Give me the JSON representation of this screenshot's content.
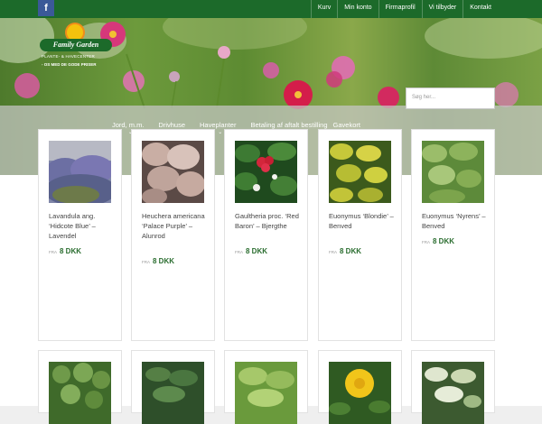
{
  "topbar": {
    "facebook_icon": "f",
    "nav": [
      "Kurv",
      "Min konto",
      "Firmaprofil",
      "Vi tilbyder",
      "Kontakt"
    ]
  },
  "logo": {
    "title": "Family Garden",
    "line1": "PLANTE- & HAVECENTER",
    "line2": "- OS MED DE GODE PRISER"
  },
  "search": {
    "placeholder": "Søg her..."
  },
  "mainnav": [
    {
      "label": "Jord, m.m.",
      "has_sub": true
    },
    {
      "label": "Drivhuse",
      "has_sub": true
    },
    {
      "label": "Haveplanter",
      "has_sub": true
    },
    {
      "label": "Betaling af aftalt bestilling",
      "has_sub": false
    },
    {
      "label": "Gavekort",
      "has_sub": false
    }
  ],
  "products": [
    {
      "name": "Lavandula ang. ‘Hidcote Blue’ – Lavendel",
      "price_prefix": "FRA",
      "price": "8 DKK"
    },
    {
      "name": "Heuchera americana ‘Palace Purple’ – Alunrod",
      "price_prefix": "FRA",
      "price": "8 DKK"
    },
    {
      "name": "Gaultheria proc. ‘Red Baron’ – Bjergthe",
      "price_prefix": "FRA",
      "price": "8 DKK"
    },
    {
      "name": "Euonymus ‘Blondie’ – Benved",
      "price_prefix": "FRA",
      "price": "8 DKK"
    },
    {
      "name": "Euonymus ‘Nyrens’ – Benved",
      "price_prefix": "FRA",
      "price": "8 DKK"
    }
  ],
  "colors": {
    "brand_green": "#1c6a2a",
    "price_green": "#2a6d2f"
  }
}
